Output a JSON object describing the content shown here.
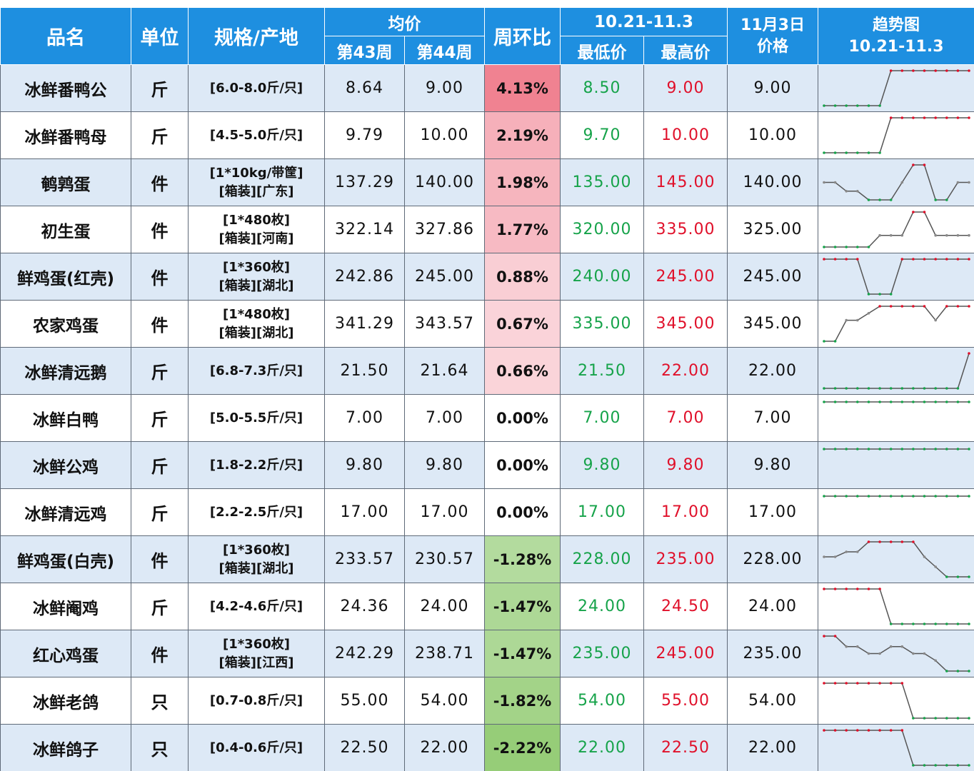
{
  "headers": {
    "name": "品名",
    "unit": "单位",
    "spec": "规格/产地",
    "avg": "均价",
    "wk43": "第43周",
    "wk44": "第44周",
    "wow": "周环比",
    "range_period": "10.21-11.3",
    "low": "最低价",
    "high": "最高价",
    "date_line1": "11月3日",
    "date_line2": "价格",
    "trend_line1": "趋势图",
    "trend_line2": "10.21-11.3"
  },
  "colors": {
    "header_bg": "#1e8fe0",
    "low_text": "#16a34a",
    "high_text": "#e0102a",
    "up_strong": "#f4b6be",
    "down_strong": "#b9dba3"
  },
  "rows": [
    {
      "name": "冰鲜番鸭公",
      "unit": "斤",
      "spec1": "[6.0-8.0斤/只]",
      "spec2": "",
      "w43": "8.64",
      "w44": "9.00",
      "pct": "4.13%",
      "pct_val": 4.13,
      "low": "8.50",
      "high": "9.00",
      "price": "9.00",
      "trend": [
        8.5,
        8.5,
        8.5,
        8.5,
        8.5,
        8.5,
        9,
        9,
        9,
        9,
        9,
        9,
        9,
        9
      ]
    },
    {
      "name": "冰鲜番鸭母",
      "unit": "斤",
      "spec1": "[4.5-5.0斤/只]",
      "spec2": "",
      "w43": "9.79",
      "w44": "10.00",
      "pct": "2.19%",
      "pct_val": 2.19,
      "low": "9.70",
      "high": "10.00",
      "price": "10.00",
      "trend": [
        9.7,
        9.7,
        9.7,
        9.7,
        9.7,
        9.7,
        10,
        10,
        10,
        10,
        10,
        10,
        10,
        10
      ]
    },
    {
      "name": "鹌鹑蛋",
      "unit": "件",
      "spec1": "[1*10kg/带筐]",
      "spec2": "[箱装][广东]",
      "w43": "137.29",
      "w44": "140.00",
      "pct": "1.98%",
      "pct_val": 1.98,
      "low": "135.00",
      "high": "145.00",
      "price": "140.00",
      "trend": [
        140,
        140,
        137.5,
        137.5,
        135,
        135,
        135,
        140,
        145,
        145,
        135,
        135,
        140,
        140
      ]
    },
    {
      "name": "初生蛋",
      "unit": "件",
      "spec1": "[1*480枚]",
      "spec2": "[箱装][河南]",
      "w43": "322.14",
      "w44": "327.86",
      "pct": "1.77%",
      "pct_val": 1.77,
      "low": "320.00",
      "high": "335.00",
      "price": "325.00",
      "trend": [
        320,
        320,
        320,
        320,
        320,
        325,
        325,
        325,
        335,
        335,
        325,
        325,
        325,
        325
      ]
    },
    {
      "name": "鲜鸡蛋(红壳)",
      "unit": "件",
      "spec1": "[1*360枚]",
      "spec2": "[箱装][湖北]",
      "w43": "242.86",
      "w44": "245.00",
      "pct": "0.88%",
      "pct_val": 0.88,
      "low": "240.00",
      "high": "245.00",
      "price": "245.00",
      "trend": [
        245,
        245,
        245,
        245,
        240,
        240,
        240,
        245,
        245,
        245,
        245,
        245,
        245,
        245
      ]
    },
    {
      "name": "农家鸡蛋",
      "unit": "件",
      "spec1": "[1*480枚]",
      "spec2": "[箱装][湖北]",
      "w43": "341.29",
      "w44": "343.57",
      "pct": "0.67%",
      "pct_val": 0.67,
      "low": "335.00",
      "high": "345.00",
      "price": "345.00",
      "trend": [
        335,
        335,
        341,
        341,
        343,
        345,
        345,
        345,
        345,
        345,
        341,
        345,
        345,
        345
      ]
    },
    {
      "name": "冰鲜清远鹅",
      "unit": "斤",
      "spec1": "[6.8-7.3斤/只]",
      "spec2": "",
      "w43": "21.50",
      "w44": "21.64",
      "pct": "0.66%",
      "pct_val": 0.66,
      "low": "21.50",
      "high": "22.00",
      "price": "22.00",
      "trend": [
        21.5,
        21.5,
        21.5,
        21.5,
        21.5,
        21.5,
        21.5,
        21.5,
        21.5,
        21.5,
        21.5,
        21.5,
        21.5,
        22
      ]
    },
    {
      "name": "冰鲜白鸭",
      "unit": "斤",
      "spec1": "[5.0-5.5斤/只]",
      "spec2": "",
      "w43": "7.00",
      "w44": "7.00",
      "pct": "0.00%",
      "pct_val": 0,
      "low": "7.00",
      "high": "7.00",
      "price": "7.00",
      "trend": [
        7,
        7,
        7,
        7,
        7,
        7,
        7,
        7,
        7,
        7,
        7,
        7,
        7,
        7
      ]
    },
    {
      "name": "冰鲜公鸡",
      "unit": "斤",
      "spec1": "[1.8-2.2斤/只]",
      "spec2": "",
      "w43": "9.80",
      "w44": "9.80",
      "pct": "0.00%",
      "pct_val": 0,
      "low": "9.80",
      "high": "9.80",
      "price": "9.80",
      "trend": [
        9.8,
        9.8,
        9.8,
        9.8,
        9.8,
        9.8,
        9.8,
        9.8,
        9.8,
        9.8,
        9.8,
        9.8,
        9.8,
        9.8
      ]
    },
    {
      "name": "冰鲜清远鸡",
      "unit": "斤",
      "spec1": "[2.2-2.5斤/只]",
      "spec2": "",
      "w43": "17.00",
      "w44": "17.00",
      "pct": "0.00%",
      "pct_val": 0,
      "low": "17.00",
      "high": "17.00",
      "price": "17.00",
      "trend": [
        17,
        17,
        17,
        17,
        17,
        17,
        17,
        17,
        17,
        17,
        17,
        17,
        17,
        17
      ]
    },
    {
      "name": "鲜鸡蛋(白壳)",
      "unit": "件",
      "spec1": "[1*360枚]",
      "spec2": "[箱装][湖北]",
      "w43": "233.57",
      "w44": "230.57",
      "pct": "-1.28%",
      "pct_val": -1.28,
      "low": "228.00",
      "high": "235.00",
      "price": "228.00",
      "trend": [
        232,
        232,
        233,
        233,
        235,
        235,
        235,
        235,
        235,
        232,
        230,
        228,
        228,
        228
      ]
    },
    {
      "name": "冰鲜阉鸡",
      "unit": "斤",
      "spec1": "[4.2-4.6斤/只]",
      "spec2": "",
      "w43": "24.36",
      "w44": "24.00",
      "pct": "-1.47%",
      "pct_val": -1.47,
      "low": "24.00",
      "high": "24.50",
      "price": "24.00",
      "trend": [
        24.5,
        24.5,
        24.5,
        24.5,
        24.5,
        24.5,
        24,
        24,
        24,
        24,
        24,
        24,
        24,
        24
      ]
    },
    {
      "name": "红心鸡蛋",
      "unit": "件",
      "spec1": "[1*360枚]",
      "spec2": "[箱装][江西]",
      "w43": "242.29",
      "w44": "238.71",
      "pct": "-1.47%",
      "pct_val": -1.47,
      "low": "235.00",
      "high": "245.00",
      "price": "235.00",
      "trend": [
        245,
        245,
        242,
        242,
        240,
        240,
        242,
        242,
        240,
        240,
        238,
        235,
        235,
        235
      ]
    },
    {
      "name": "冰鲜老鸽",
      "unit": "只",
      "spec1": "[0.7-0.8斤/只]",
      "spec2": "",
      "w43": "55.00",
      "w44": "54.00",
      "pct": "-1.82%",
      "pct_val": -1.82,
      "low": "54.00",
      "high": "55.00",
      "price": "54.00",
      "trend": [
        55,
        55,
        55,
        55,
        55,
        55,
        55,
        55,
        54,
        54,
        54,
        54,
        54,
        54
      ]
    },
    {
      "name": "冰鲜鸽子",
      "unit": "只",
      "spec1": "[0.4-0.6斤/只]",
      "spec2": "",
      "w43": "22.50",
      "w44": "22.00",
      "pct": "-2.22%",
      "pct_val": -2.22,
      "low": "22.00",
      "high": "22.50",
      "price": "22.00",
      "trend": [
        22.5,
        22.5,
        22.5,
        22.5,
        22.5,
        22.5,
        22.5,
        22.5,
        22,
        22,
        22,
        22,
        22,
        22
      ]
    }
  ]
}
